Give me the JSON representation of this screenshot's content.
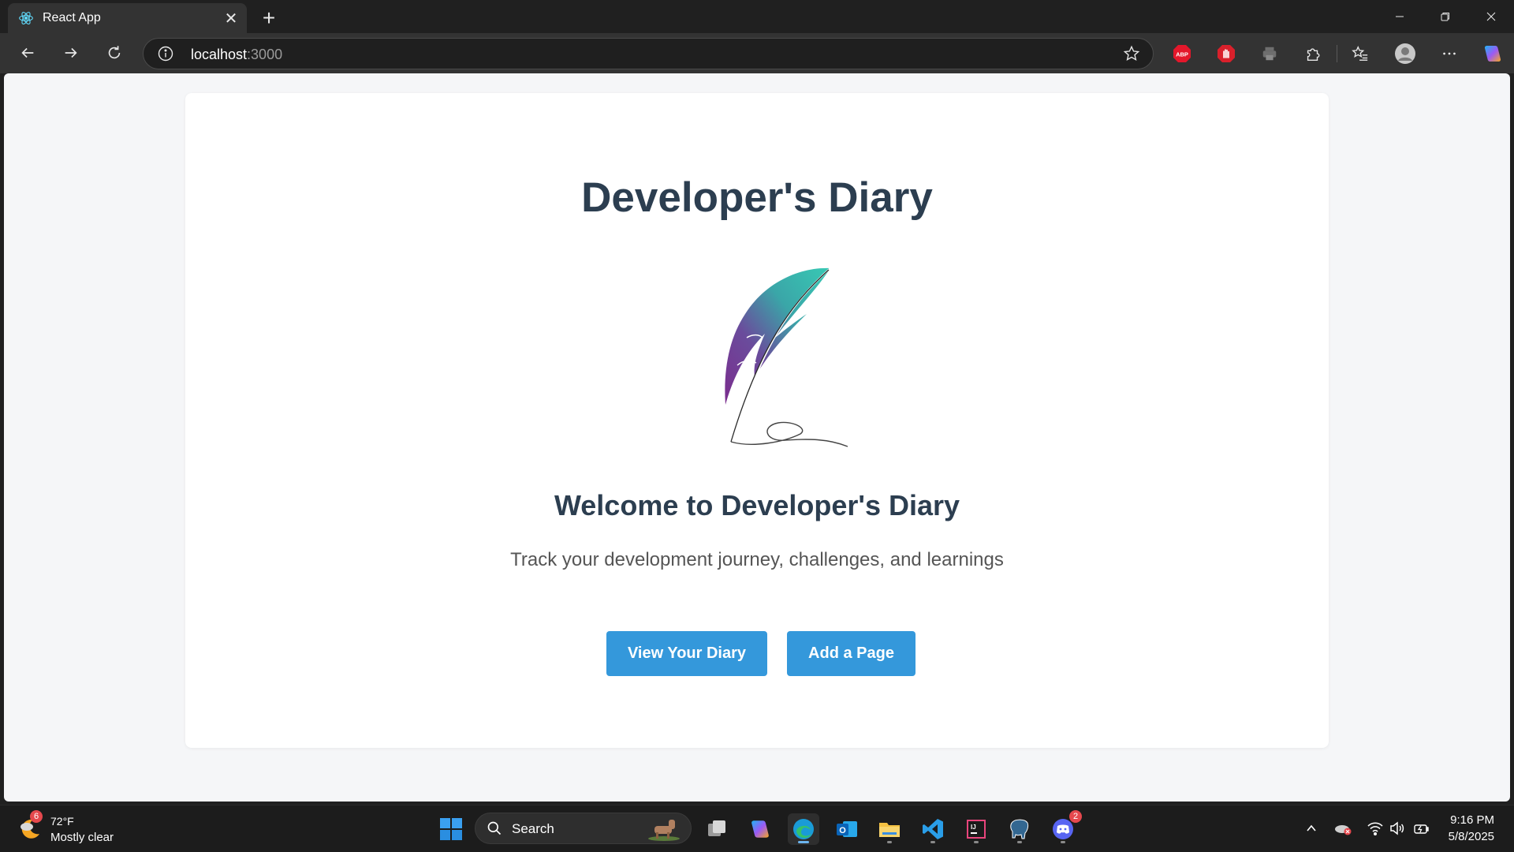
{
  "browser": {
    "tab_title": "React App",
    "address_host": "localhost",
    "address_port": ":3000",
    "extensions": [
      "adblock-plus-icon",
      "stop-hand-icon",
      "printer-icon",
      "puzzle-icon"
    ],
    "colors": {
      "chrome_bg": "#202020",
      "toolbar_bg": "#333333"
    }
  },
  "page": {
    "title": "Developer's Diary",
    "welcome": "Welcome to Developer's Diary",
    "tagline": "Track your development journey, challenges, and learnings",
    "buttons": {
      "view_diary": "View Your Diary",
      "add_page": "Add a Page"
    },
    "colors": {
      "heading": "#2c3e50",
      "button": "#3498db",
      "page_bg": "#f5f6f8"
    }
  },
  "taskbar": {
    "weather_badge": "6",
    "weather_temp": "72°F",
    "weather_desc": "Mostly clear",
    "search_label": "Search",
    "discord_badge": "2",
    "time": "9:16 PM",
    "date": "5/8/2025"
  }
}
